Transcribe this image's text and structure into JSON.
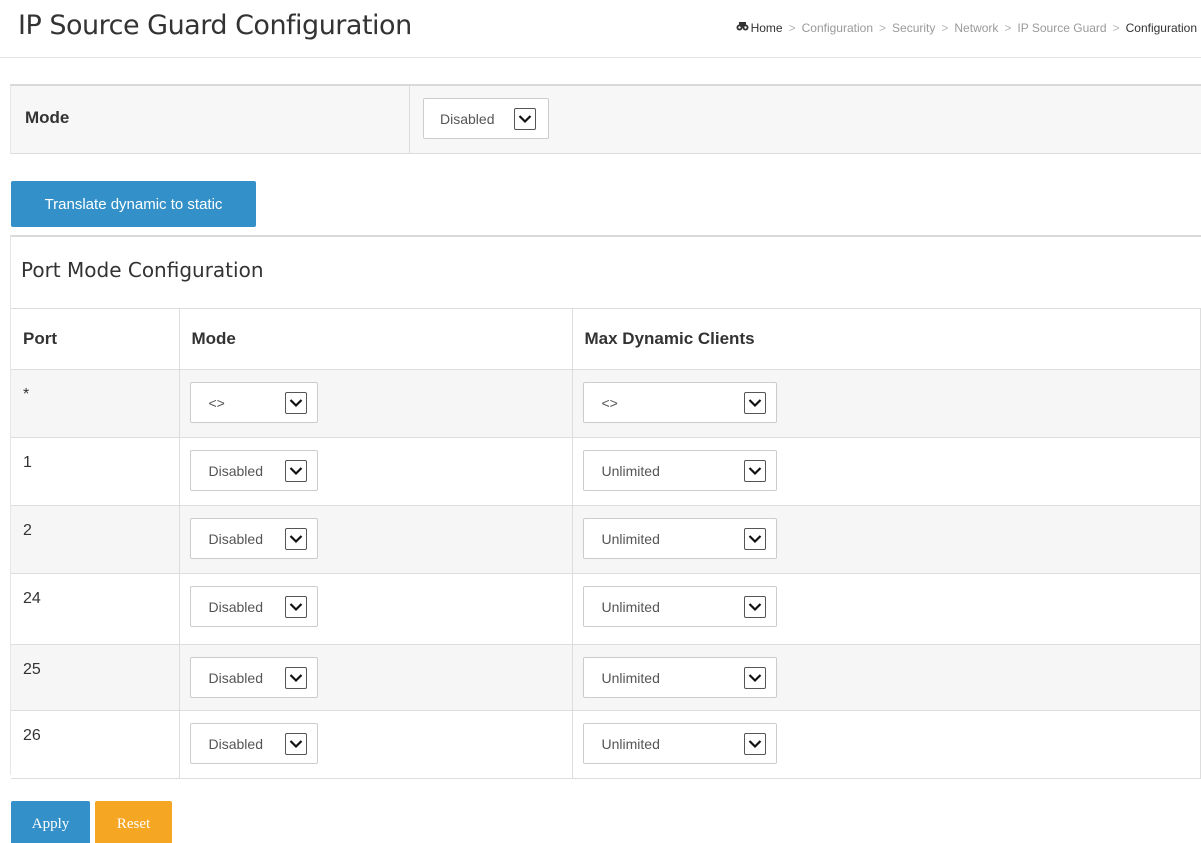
{
  "page": {
    "title": "IP Source Guard Configuration"
  },
  "breadcrumb": {
    "home": "Home",
    "items": [
      "Configuration",
      "Security",
      "Network",
      "IP Source Guard"
    ],
    "current": "Configuration"
  },
  "global_mode": {
    "label": "Mode",
    "value": "Disabled"
  },
  "translate_button": "Translate dynamic to static",
  "port_panel": {
    "title": "Port Mode Configuration",
    "columns": [
      "Port",
      "Mode",
      "Max Dynamic Clients"
    ],
    "rows": [
      {
        "port": "*",
        "mode": "<>",
        "max": "<>"
      },
      {
        "port": "1",
        "mode": "Disabled",
        "max": "Unlimited"
      },
      {
        "port": "2",
        "mode": "Disabled",
        "max": "Unlimited"
      },
      {
        "port": "24",
        "mode": "Disabled",
        "max": "Unlimited"
      },
      {
        "port": "25",
        "mode": "Disabled",
        "max": "Unlimited"
      },
      {
        "port": "26",
        "mode": "Disabled",
        "max": "Unlimited"
      }
    ]
  },
  "actions": {
    "apply": "Apply",
    "reset": "Reset"
  },
  "colors": {
    "primary": "#3390c8",
    "warning": "#f5a623"
  }
}
